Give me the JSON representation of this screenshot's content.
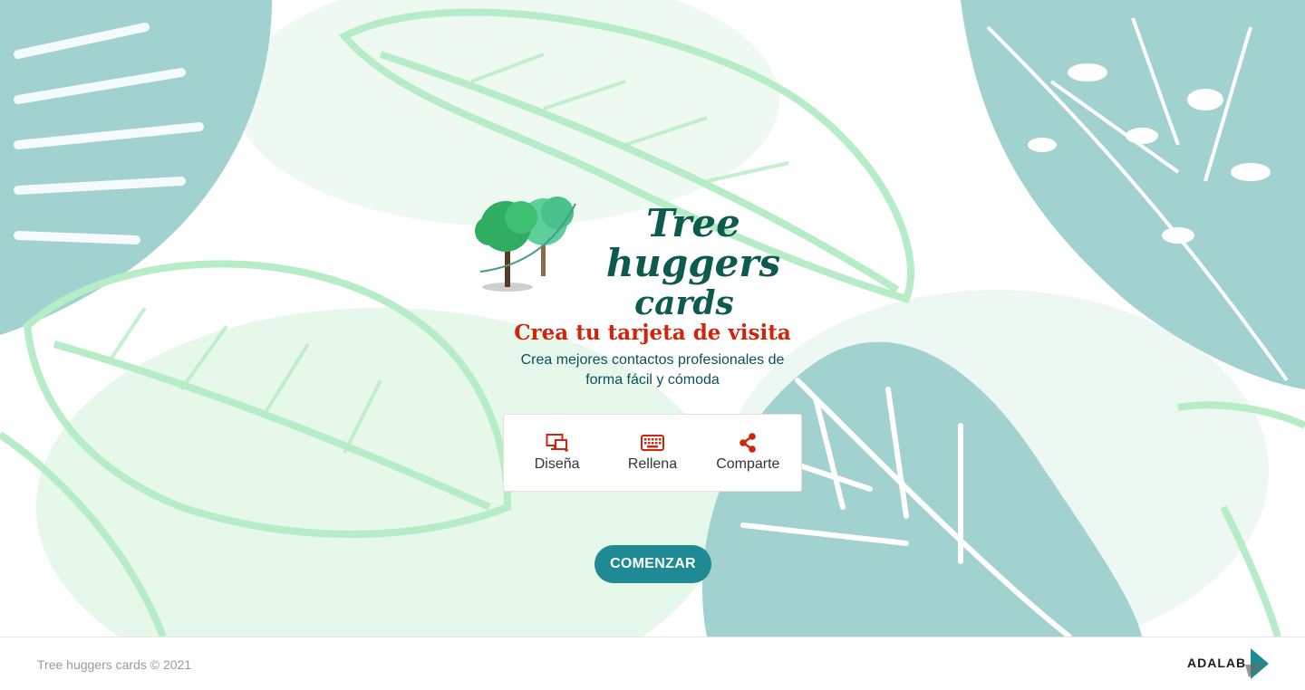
{
  "brand": {
    "logo_line1": "Tree huggers",
    "logo_line2": "cards"
  },
  "hero": {
    "title": "Crea tu tarjeta de visita",
    "subtitle": "Crea mejores contactos profesionales de forma fácil y cómoda"
  },
  "steps": [
    {
      "label": "Diseña",
      "icon": "design-icon"
    },
    {
      "label": "Rellena",
      "icon": "keyboard-icon"
    },
    {
      "label": "Comparte",
      "icon": "share-icon"
    }
  ],
  "cta": {
    "label": "COMENZAR"
  },
  "footer": {
    "copyright": "Tree huggers cards © 2021",
    "partner_logo": "ADALAB"
  },
  "colors": {
    "title_red": "#d2230b",
    "icon_red": "#d2230b",
    "cta_teal": "#1f8a93",
    "leaf_teal": "#a2d2cf",
    "leaf_mint": "#b6ecc6",
    "brand_green": "#0d5a4f"
  }
}
